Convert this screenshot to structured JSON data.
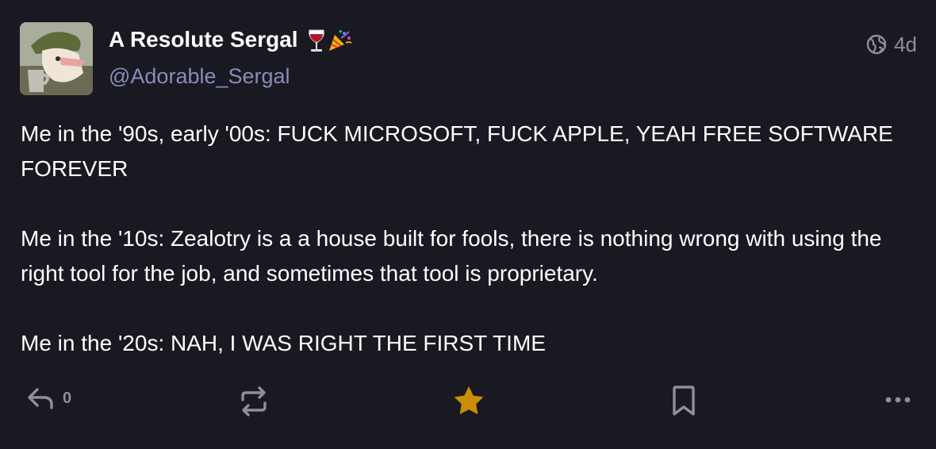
{
  "post": {
    "author": {
      "display_name": "A Resolute Sergal",
      "handle": "@Adorable_Sergal",
      "emoji": [
        "wine-glass",
        "party-popper"
      ]
    },
    "visibility": "globe-icon",
    "timestamp": "4d",
    "content": {
      "paragraphs": [
        "Me in the '90s, early '00s: FUCK MICROSOFT, FUCK APPLE, YEAH FREE SOFTWARE FOREVER",
        "Me in the '10s: Zealotry is a a house built for fools, there is nothing wrong with using the right tool for the job, and sometimes that tool is proprietary.",
        "Me in the '20s: NAH, I WAS RIGHT THE FIRST TIME"
      ]
    },
    "actions": {
      "reply_count": "0",
      "favourite_active": true
    }
  },
  "colors": {
    "background": "#191922",
    "handle": "#8d8ab8",
    "muted": "#8e8ea0",
    "favourite": "#ca8f04"
  }
}
